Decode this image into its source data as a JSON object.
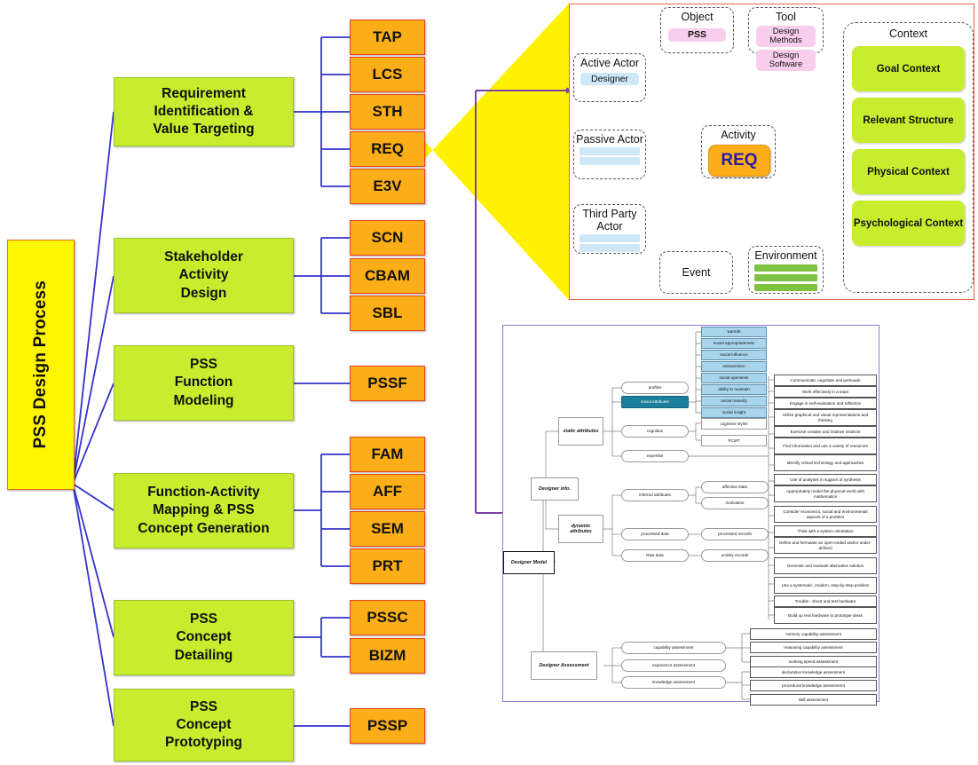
{
  "root": {
    "label": "PSS Design Process"
  },
  "phases": [
    {
      "id": "p1",
      "label": "Requirement Identification & Value Targeting",
      "lines": [
        "Requirement",
        "Identification &",
        "Value Targeting"
      ]
    },
    {
      "id": "p2",
      "label": "Stakeholder Activity Design",
      "lines": [
        "Stakeholder",
        "Activity",
        "Design"
      ]
    },
    {
      "id": "p3",
      "label": "PSS Function Modeling",
      "lines": [
        "PSS",
        "Function",
        "Modeling"
      ]
    },
    {
      "id": "p4",
      "label": "Function-Activity Mapping & PSS Concept Generation",
      "lines": [
        "Function-Activity",
        "Mapping & PSS",
        "Concept Generation"
      ]
    },
    {
      "id": "p5",
      "label": "PSS Concept Detailing",
      "lines": [
        "PSS",
        "Concept",
        "Detailing"
      ]
    },
    {
      "id": "p6",
      "label": "PSS Concept Prototyping",
      "lines": [
        "PSS",
        "Concept",
        "Prototyping"
      ]
    }
  ],
  "methods": {
    "p1": [
      "TAP",
      "LCS",
      "STH",
      "REQ",
      "E3V"
    ],
    "p2": [
      "SCN",
      "CBAM",
      "SBL"
    ],
    "p3": [
      "PSSF"
    ],
    "p4": [
      "FAM",
      "AFF",
      "SEM",
      "PRT"
    ],
    "p5": [
      "PSSC",
      "BIZM"
    ],
    "p6": [
      "PSSP"
    ]
  },
  "activity_panel": {
    "object": {
      "title": "Object",
      "items": [
        "PSS"
      ]
    },
    "tool": {
      "title": "Tool",
      "items": [
        "Design Methods",
        "Design Software"
      ]
    },
    "active_actor": {
      "title": "Active Actor",
      "items": [
        "Designer"
      ]
    },
    "passive_actor": {
      "title": "Passive Actor",
      "items": [
        "",
        ""
      ]
    },
    "third_party_actor": {
      "title": "Third Party Actor",
      "items": [
        "",
        ""
      ]
    },
    "activity": {
      "title": "Activity",
      "value": "REQ"
    },
    "event": {
      "title": "Event"
    },
    "environment": {
      "title": "Environment",
      "items": [
        "",
        "",
        ""
      ]
    },
    "context": {
      "title": "Context",
      "items": [
        "Goal Context",
        "Relevant Structure",
        "Physical Context",
        "Psychological Context"
      ]
    }
  },
  "designer_model": {
    "root": "Designer Model",
    "branch_info": "Designer info.",
    "branch_assessment": "Designer Assessment",
    "static_attributes": "static attributes",
    "dynamic_attributes": "dynamic attributes",
    "static_children": [
      "profiles",
      "social attributes",
      "cognition",
      "expertise"
    ],
    "social_attributes": [
      "warmth",
      "social appropriateness",
      "social influence",
      "extraversion",
      "social openness",
      "ability to maintain",
      "social maturity",
      "social insight"
    ],
    "cognition_children": [
      "cognitive styles",
      "PCMT"
    ],
    "expertise_children": [
      "Communicate, negotiate and persuade",
      "Work effectively in a team",
      "Engage in self-evaluation and reflection",
      "Utilize graphical and visual representations and thinking",
      "Exercise creative and intuitive instincts",
      "Find information and use a variety of resources",
      "Identify critical technology and approaches",
      "Use of analyses in support of synthesis",
      "Appropriately model the physical world with mathematics",
      "Consider economics, social and environmental aspects of a problem",
      "Think with a system orientation",
      "Define and formulate an open-ended and/or under-defined",
      "Generate and evaluate alternative solution",
      "Use a systematic, modern, step-by-step problem",
      "Trouble - shoot and test hardware",
      "Build up real hardware to prototype ideas"
    ],
    "dynamic_children": [
      "inferred attributes",
      "processed data",
      "Raw data"
    ],
    "inferred_children": [
      "affective state",
      "motivation"
    ],
    "processed_children": [
      "processed records"
    ],
    "raw_children": [
      "activity records"
    ],
    "assessment_children": [
      "capability assessment",
      "experience assessment",
      "knowledge assessment"
    ],
    "capability_children": [
      "memory capability assessment",
      "reasoning capability assessment",
      "working speed assessment"
    ],
    "knowledge_children": [
      "declarative knowledge assessment",
      "procedural knowledge assessment",
      "skill assessment"
    ]
  },
  "colors": {
    "root_yellow": "#FFF500",
    "phase_green": "#C8EC2E",
    "method_orange": "#FBAE17",
    "wire_blue": "#3333CC",
    "highlight_yellow": "#FFF200",
    "panel_red": "#E8604B",
    "panel_purple": "#8A7FD4",
    "teal_highlight": "#1C7E9C",
    "blue_row": "#A8D4EC",
    "pink_chip": "#F9CDEC"
  }
}
